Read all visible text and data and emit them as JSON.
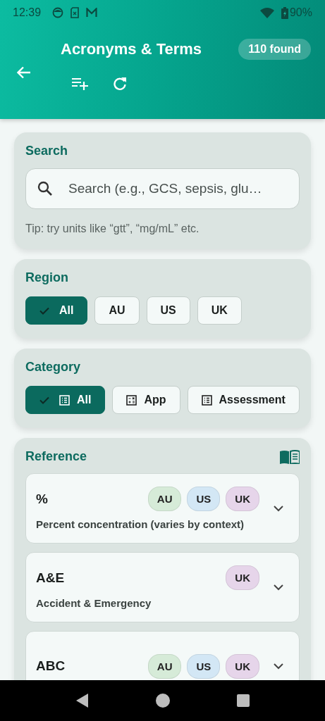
{
  "status_bar": {
    "time": "12:39",
    "battery": "90%"
  },
  "header": {
    "title": "Acronyms & Terms",
    "count": "110 found"
  },
  "search": {
    "title": "Search",
    "placeholder": "Search (e.g., GCS, sepsis, glu…",
    "tip": "Tip: try units like “gtt”, “mg/mL” etc."
  },
  "region": {
    "title": "Region",
    "chips": [
      {
        "label": "All",
        "selected": true
      },
      {
        "label": "AU",
        "selected": false
      },
      {
        "label": "US",
        "selected": false
      },
      {
        "label": "UK",
        "selected": false
      }
    ]
  },
  "category": {
    "title": "Category",
    "chips": [
      {
        "label": "All",
        "selected": true,
        "kind": "list"
      },
      {
        "label": "App",
        "selected": false,
        "kind": "calculator"
      },
      {
        "label": "Assessment",
        "selected": false,
        "kind": "list"
      }
    ]
  },
  "reference": {
    "title": "Reference",
    "entries": [
      {
        "term": "%",
        "definition": "Percent concentration (varies by context)",
        "expanded": false,
        "tags": [
          {
            "label": "AU",
            "color": "#d6ebd8"
          },
          {
            "label": "US",
            "color": "#d3e7f5"
          },
          {
            "label": "UK",
            "color": "#e6d5ea"
          }
        ]
      },
      {
        "term": "A&E",
        "definition": "Accident & Emergency",
        "expanded": false,
        "tags": [
          {
            "label": "UK",
            "color": "#e6d5ea"
          }
        ]
      },
      {
        "term": "ABC",
        "expanded": false,
        "tags": [
          {
            "label": "AU",
            "color": "#d6ebd8"
          },
          {
            "label": "US",
            "color": "#d3e7f5"
          },
          {
            "label": "UK",
            "color": "#e6d5ea"
          }
        ]
      }
    ]
  }
}
